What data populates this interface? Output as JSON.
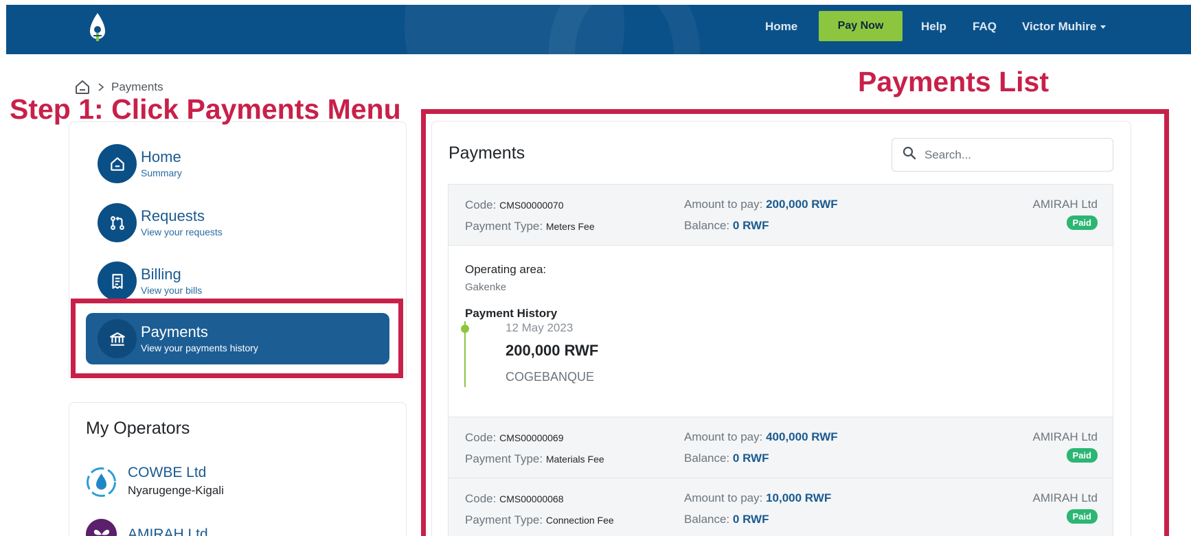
{
  "nav": {
    "home": "Home",
    "pay_now": "Pay Now",
    "help": "Help",
    "faq": "FAQ",
    "user": "Victor Muhire"
  },
  "breadcrumb": {
    "current": "Payments"
  },
  "annotations": {
    "step": "Step 1: Click Payments Menu",
    "list": "Payments List",
    "color": "#c8204a"
  },
  "menu": {
    "items": [
      {
        "title": "Home",
        "subtitle": "Summary",
        "icon": "home-icon"
      },
      {
        "title": "Requests",
        "subtitle": "View your requests",
        "icon": "pull-request-icon"
      },
      {
        "title": "Billing",
        "subtitle": "View your bills",
        "icon": "receipt-icon"
      },
      {
        "title": "Payments",
        "subtitle": "View your payments history",
        "icon": "bank-icon",
        "active": true
      }
    ]
  },
  "operators": {
    "heading": "My Operators",
    "items": [
      {
        "name": "COWBE Ltd",
        "location": "Nyarugenge-Kigali",
        "icon": "water-drop-icon"
      },
      {
        "name": "AMIRAH Ltd",
        "location": "",
        "icon": "butterfly-icon"
      }
    ]
  },
  "payments": {
    "title": "Payments",
    "search_placeholder": "Search...",
    "labels": {
      "code": "Code:",
      "payment_type": "Payment Type:",
      "amount": "Amount to pay:",
      "balance": "Balance:",
      "operating_area": "Operating area:",
      "payment_history": "Payment History"
    },
    "rows": [
      {
        "code": "CMS00000070",
        "payment_type": "Meters Fee",
        "amount": "200,000 RWF",
        "balance": "0 RWF",
        "company": "AMIRAH Ltd",
        "status": "Paid",
        "expanded": true,
        "operating_area": "Gakenke",
        "history": [
          {
            "date": "12 May 2023",
            "amount": "200,000 RWF",
            "bank": "COGEBANQUE"
          }
        ]
      },
      {
        "code": "CMS00000069",
        "payment_type": "Materials Fee",
        "amount": "400,000 RWF",
        "balance": "0 RWF",
        "company": "AMIRAH Ltd",
        "status": "Paid"
      },
      {
        "code": "CMS00000068",
        "payment_type": "Connection Fee",
        "amount": "10,000 RWF",
        "balance": "0 RWF",
        "company": "AMIRAH Ltd",
        "status": "Paid"
      }
    ]
  },
  "colors": {
    "nav_bg": "#0b5189",
    "pay_now_bg": "#8cc63f",
    "active_menu": "#1c5d94",
    "paid_badge": "#2bb673"
  }
}
